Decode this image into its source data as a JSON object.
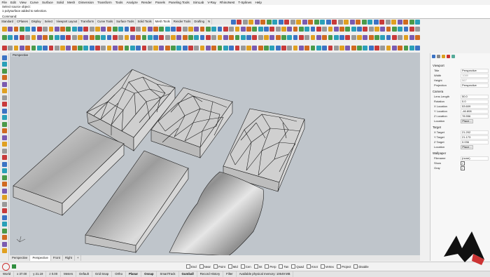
{
  "menu": [
    "File",
    "Edit",
    "View",
    "Curve",
    "Surface",
    "Solid",
    "Mesh",
    "Dimension",
    "Transform",
    "Tools",
    "Analyze",
    "Render",
    "Panels",
    "Paneling Tools",
    "SimLab",
    "V-Ray",
    "RhinoNest",
    "T-Splines",
    "Help"
  ],
  "command_history": [
    "Select source object:",
    "1 polysurface added to selection."
  ],
  "command_prompt": "Command:",
  "toolbar_tabs": [
    "Standard",
    "CPlanes",
    "Display",
    "Select",
    "Viewport Layout",
    "Transform",
    "Curve Tools",
    "Surface Tools",
    "Solid Tools",
    "Mesh Tools",
    "Render Tools",
    "Drafting",
    "N"
  ],
  "active_toolbar_tab": "Mesh Tools",
  "viewport": {
    "label": "Perspective",
    "tabs": [
      "Perspective",
      "Perspective",
      "Front",
      "Right"
    ],
    "active_tab": "Perspective"
  },
  "osnaps": [
    "End",
    "Near",
    "Point",
    "Mid",
    "Cen",
    "Int",
    "Perp",
    "Tan",
    "Quad",
    "Knot",
    "Vertex",
    "Project",
    "Disable"
  ],
  "status": {
    "cplane": "World",
    "x": "x 37.00",
    "y": "y 21.19",
    "z": "z 0.00",
    "units": "Meters",
    "layer": "Default",
    "grid_snap": "Grid Snap",
    "ortho": "Ortho",
    "planar": "Planar",
    "osnap": "Osnap",
    "smarttrack": "SmartTrack",
    "gumball": "Gumball",
    "record_history": "Record History",
    "filter": "Filter",
    "memory": "Available physical memory: 10649 MB"
  },
  "properties": {
    "viewport_header": "Viewport",
    "title_label": "Title",
    "title_value": "Perspective",
    "width_label": "Width",
    "width_value": "1089",
    "height_label": "Height",
    "height_value": "567",
    "projection_label": "Projection",
    "projection_value": "Perspective",
    "camera_header": "Camera",
    "lens_label": "Lens Length",
    "lens_value": "50.0",
    "rotation_label": "Rotation",
    "rotation_value": "0.0",
    "xloc_label": "X Location",
    "xloc_value": "53.609",
    "yloc_label": "Y Location",
    "yloc_value": "-46.808",
    "zloc_label": "Z Location",
    "zloc_value": "78.556",
    "location_label": "Location",
    "place_label": "Place...",
    "target_header": "Target",
    "xtar_label": "X Target",
    "xtar_value": "21.202",
    "ytar_label": "Y Target",
    "ytar_value": "21.173",
    "ztar_label": "Z Target",
    "ztar_value": "0.036",
    "tlocation_label": "Location",
    "tplace_label": "Place...",
    "wallpaper_header": "Wallpaper",
    "filename_label": "Filename",
    "filename_value": "(none)",
    "show_label": "Show",
    "gray_label": "Gray"
  },
  "colors": {
    "viewport_bg": "#bfc5cb",
    "mesh_wire": "#1a1a1a",
    "accent": "#3b73c4"
  }
}
